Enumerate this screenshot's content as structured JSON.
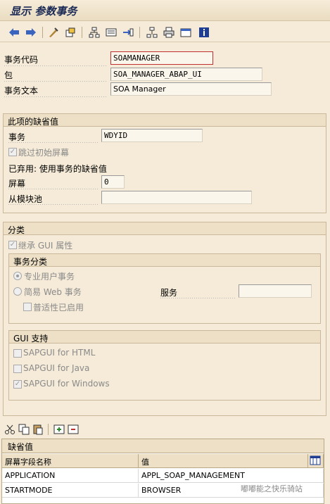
{
  "window": {
    "title": "显示 参数事务"
  },
  "toolbar": {
    "icons": [
      "back-arrow-icon",
      "forward-arrow-icon",
      "display-change-icon",
      "other-object-icon",
      "hierarchy-icon",
      "where-used-icon",
      "navigate-icon",
      "object-list-icon",
      "print-icon",
      "window-icon",
      "info-icon"
    ]
  },
  "header": {
    "tcode_label": "事务代码",
    "tcode_value": "SOAMANAGER",
    "package_label": "包",
    "package_value": "SOA_MANAGER_ABAP_UI",
    "text_label": "事务文本",
    "text_value": "SOA Manager"
  },
  "defaults": {
    "group_title": "此项的缺省值",
    "transaction_label": "事务",
    "transaction_value": "WDYID",
    "skip_screen_label": "跳过初始屏幕",
    "obsolete_text": "已弃用: 使用事务的缺省值",
    "screen_label": "屏幕",
    "screen_value": "0",
    "module_pool_label": "从模块池",
    "module_pool_value": ""
  },
  "classification": {
    "group_title": "分类",
    "inherit_gui_label": "继承 GUI 属性",
    "tx_class": {
      "title": "事务分类",
      "professional_label": "专业用户事务",
      "easy_web_label": "简易 Web 事务",
      "service_label": "服务",
      "service_value": "",
      "pervasive_label": "普适性已启用"
    },
    "gui_support": {
      "title": "GUI 支持",
      "html_label": "SAPGUI for HTML",
      "java_label": "SAPGUI for Java",
      "windows_label": "SAPGUI for Windows"
    }
  },
  "table": {
    "title": "缺省值",
    "columns": [
      "屏幕字段名称",
      "值"
    ],
    "rows": [
      [
        "APPLICATION",
        "APPL_SOAP_MANAGEMENT"
      ],
      [
        "STARTMODE",
        "BROWSER"
      ]
    ]
  },
  "watermark": "嘟嘟能之快乐骑站"
}
